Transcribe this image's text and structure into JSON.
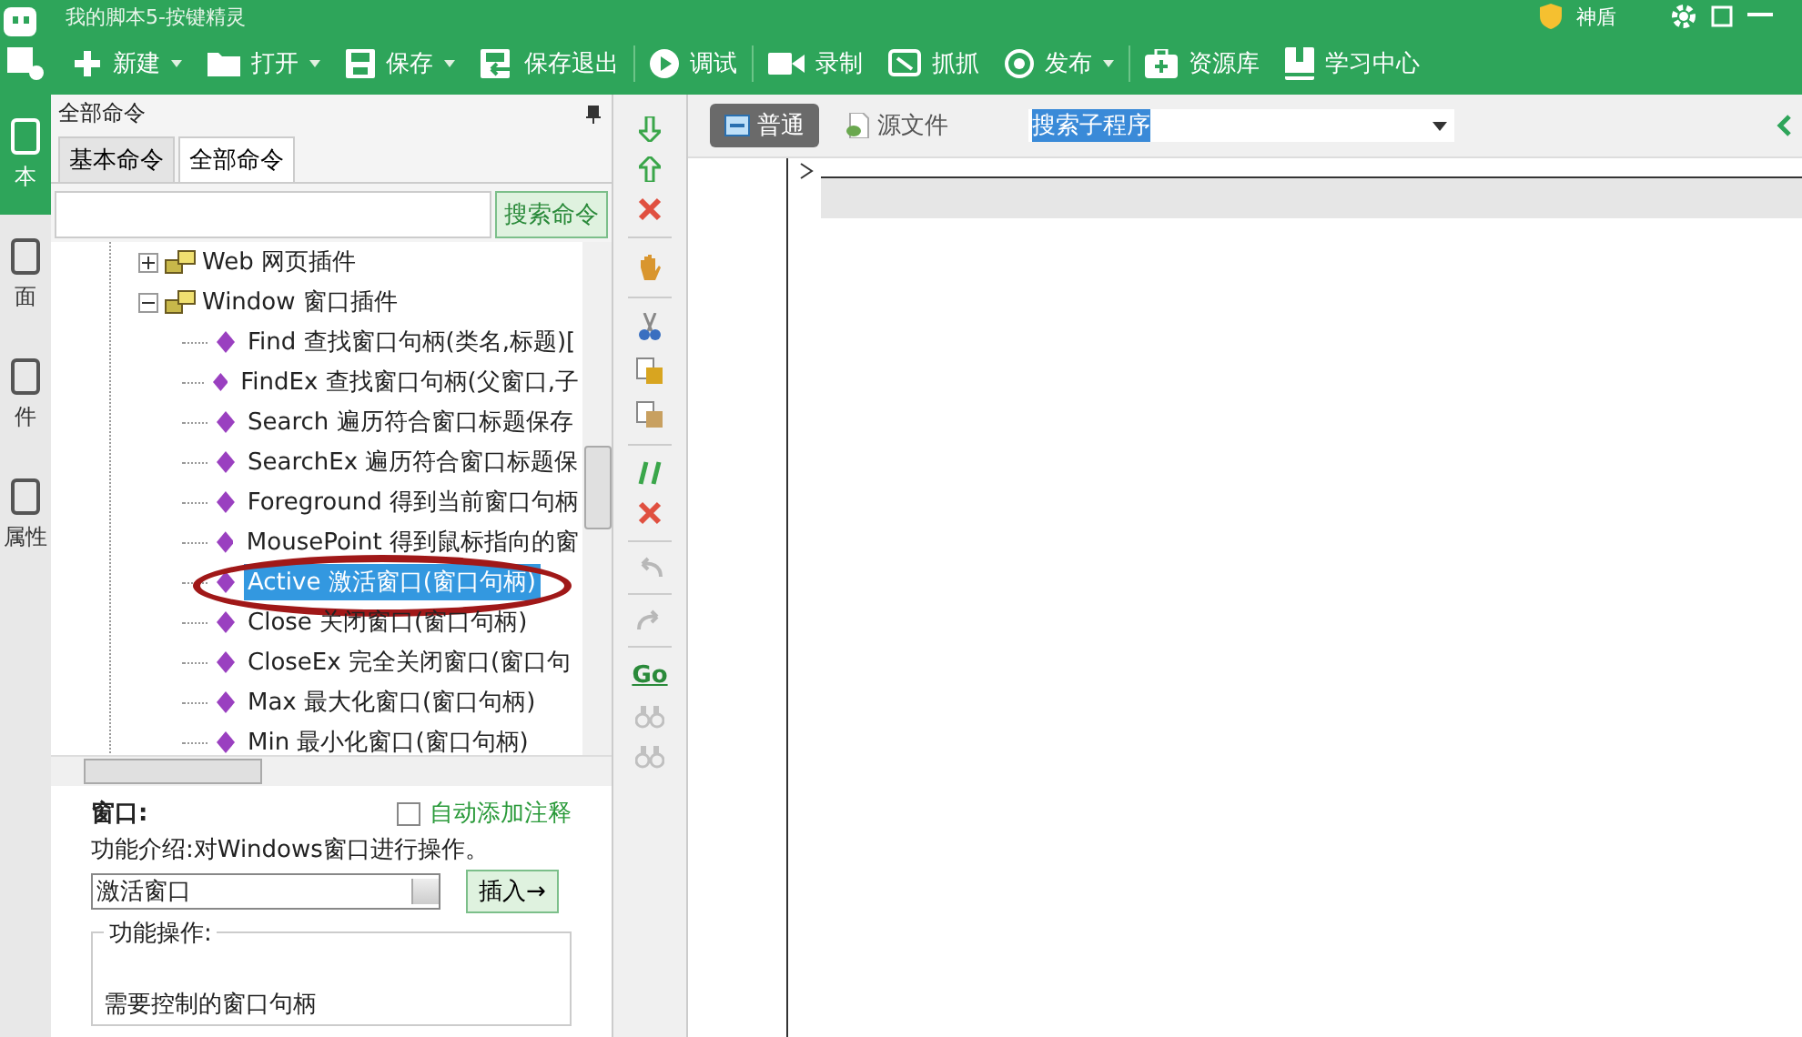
{
  "window": {
    "title": "我的脚本5-按键精灵",
    "shield_label": "神盾"
  },
  "toolbar": [
    {
      "kind": "new",
      "label": "新建",
      "dropdown": true
    },
    {
      "kind": "open",
      "label": "打开",
      "dropdown": true
    },
    {
      "kind": "save",
      "label": "保存",
      "dropdown": true
    },
    {
      "kind": "save-exit",
      "label": "保存退出",
      "dropdown": false
    },
    {
      "kind": "debug",
      "label": "调试",
      "dropdown": false
    },
    {
      "kind": "record",
      "label": "录制",
      "dropdown": false
    },
    {
      "kind": "grab",
      "label": "抓抓",
      "dropdown": false
    },
    {
      "kind": "publish",
      "label": "发布",
      "dropdown": true
    },
    {
      "kind": "library",
      "label": "资源库",
      "dropdown": false
    },
    {
      "kind": "learn",
      "label": "学习中心",
      "dropdown": false
    }
  ],
  "sidebar": {
    "items": [
      {
        "label": "本",
        "selected": true
      },
      {
        "label": "面",
        "selected": false
      },
      {
        "label": "件",
        "selected": false
      },
      {
        "label": "属性",
        "selected": false
      }
    ]
  },
  "command_panel": {
    "title": "全部命令",
    "tabs": [
      {
        "label": "基本命令",
        "selected": false
      },
      {
        "label": "全部命令",
        "selected": true
      }
    ],
    "search_button": "搜索命令",
    "tree": [
      {
        "label": "Web 网页插件",
        "expanded": false
      },
      {
        "label": "Window 窗口插件",
        "expanded": true,
        "children": [
          {
            "label": "Find 查找窗口句柄(类名,标题)[",
            "selected": false,
            "circled": false
          },
          {
            "label": "FindEx 查找窗口句柄(父窗口,子",
            "selected": false,
            "circled": false
          },
          {
            "label": "Search 遍历符合窗口标题保存",
            "selected": false,
            "circled": false
          },
          {
            "label": "SearchEx 遍历符合窗口标题保",
            "selected": false,
            "circled": false
          },
          {
            "label": "Foreground 得到当前窗口句柄",
            "selected": false,
            "circled": false
          },
          {
            "label": "MousePoint 得到鼠标指向的窗",
            "selected": false,
            "circled": false
          },
          {
            "label": "Active 激活窗口(窗口句柄)",
            "selected": true,
            "circled": true
          },
          {
            "label": "Close 关闭窗口(窗口句柄)",
            "selected": false,
            "circled": false
          },
          {
            "label": "CloseEx 完全关闭窗口(窗口句",
            "selected": false,
            "circled": false
          },
          {
            "label": "Max 最大化窗口(窗口句柄)",
            "selected": false,
            "circled": false
          },
          {
            "label": "Min 最小化窗口(窗口句柄)",
            "selected": false,
            "circled": false
          }
        ]
      }
    ]
  },
  "detail": {
    "heading": "窗口:",
    "auto_comment": {
      "label": "自动添加注释",
      "checked": false
    },
    "description": "功能介绍:对Windows窗口进行操作。",
    "select_value": "激活窗口",
    "insert_button": "插入→",
    "group_title": "功能操作:",
    "group_text": "需要控制的窗口句柄"
  },
  "tools": [
    {
      "kind": "down"
    },
    {
      "kind": "up"
    },
    {
      "kind": "delete"
    },
    {
      "kind": "sep"
    },
    {
      "kind": "hand"
    },
    {
      "kind": "sep"
    },
    {
      "kind": "cut"
    },
    {
      "kind": "copy"
    },
    {
      "kind": "paste"
    },
    {
      "kind": "sep"
    },
    {
      "kind": "comment"
    },
    {
      "kind": "uncomment"
    },
    {
      "kind": "sep"
    },
    {
      "kind": "undo"
    },
    {
      "kind": "sep"
    },
    {
      "kind": "redo"
    },
    {
      "kind": "sep"
    },
    {
      "kind": "go",
      "label": "Go"
    },
    {
      "kind": "find"
    },
    {
      "kind": "find"
    }
  ],
  "editor": {
    "tabs": [
      {
        "label": "普通",
        "selected": true
      },
      {
        "label": "源文件",
        "selected": false
      }
    ],
    "subroutine_search": "搜索子程序"
  }
}
